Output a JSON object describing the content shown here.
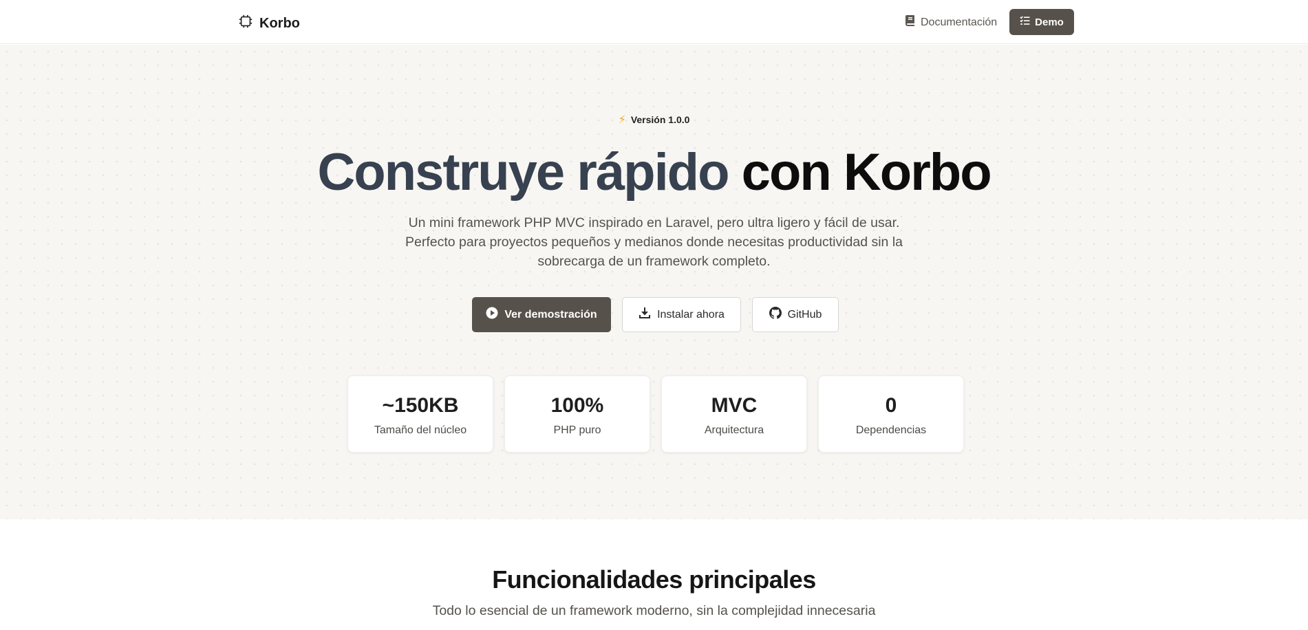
{
  "nav": {
    "brand": "Korbo",
    "doc_label": "Documentación",
    "demo_label": "Demo"
  },
  "hero": {
    "version": "Versión 1.0.0",
    "title_part1": "Construye rápido",
    "title_part2": "con Korbo",
    "subtitle": "Un mini framework PHP MVC inspirado en Laravel, pero ultra ligero y fácil de usar. Perfecto para proyectos pequeños y medianos donde necesitas productividad sin la sobrecarga de un framework completo.",
    "buttons": {
      "demo": "Ver demostración",
      "install": "Instalar ahora",
      "github": "GitHub"
    },
    "stats": [
      {
        "value": "~150KB",
        "label": "Tamaño del núcleo"
      },
      {
        "value": "100%",
        "label": "PHP puro"
      },
      {
        "value": "MVC",
        "label": "Arquitectura"
      },
      {
        "value": "0",
        "label": "Dependencias"
      }
    ]
  },
  "features": {
    "title": "Funcionalidades principales",
    "subtitle": "Todo lo esencial de un framework moderno, sin la complejidad innecesaria"
  },
  "colors": {
    "primary_button": "#57514b",
    "hero_bg": "#f7f6f3",
    "title_accent": "#37414f",
    "bolt": "#f0a91a"
  },
  "icons": {
    "brand": "cpu-chip-icon",
    "doc": "book-icon",
    "demo": "list-check-icon",
    "version": "bolt-icon",
    "play": "play-circle-icon",
    "install": "download-icon",
    "github": "github-icon"
  }
}
